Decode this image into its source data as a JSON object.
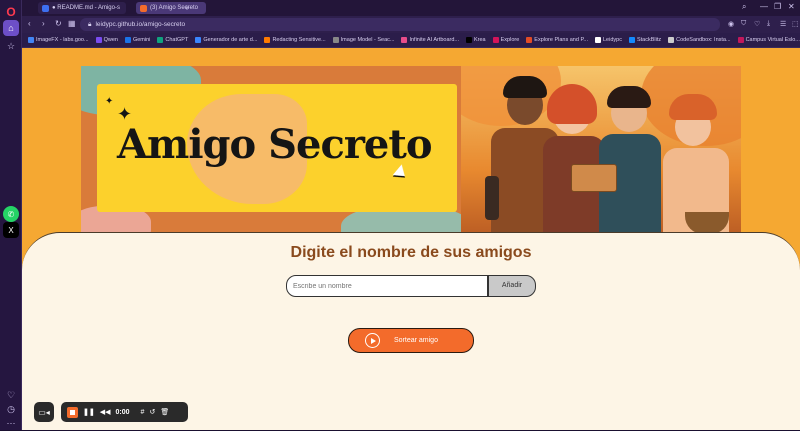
{
  "browser": {
    "tabs": [
      {
        "label": "● README.md - Amigo-s"
      },
      {
        "label": "(3) Amigo Secreto"
      }
    ],
    "new_tab_icon": "+",
    "url": "leidypc.github.io/amigo-secreto",
    "window_controls": {
      "search": "⌕",
      "minimize": "—",
      "restore": "❐",
      "close": "✕"
    }
  },
  "bookmarks": [
    {
      "label": "ImageFX - labs.goo...",
      "color": "#4285f4"
    },
    {
      "label": "Qwen",
      "color": "#7a4cf0"
    },
    {
      "label": "Gemini",
      "color": "#1a73e8"
    },
    {
      "label": "ChatGPT",
      "color": "#10a37f"
    },
    {
      "label": "Generador de arte d...",
      "color": "#3a86ff"
    },
    {
      "label": "Redacting Sensitive...",
      "color": "#ff7a00"
    },
    {
      "label": "Image Model - Seac...",
      "color": "#888888"
    },
    {
      "label": "Infinite AI Artboard...",
      "color": "#e84d8a"
    },
    {
      "label": "Krea",
      "color": "#000000"
    },
    {
      "label": "Explore",
      "color": "#d4145a"
    },
    {
      "label": "Explore Plans and P...",
      "color": "#e34c26"
    },
    {
      "label": "Leidypc",
      "color": "#ffffff"
    },
    {
      "label": "StackBlitz",
      "color": "#1389fd"
    },
    {
      "label": "CodeSandbox: Insta...",
      "color": "#cccccc"
    },
    {
      "label": "Campus Virtual Eslo...",
      "color": "#c2185b"
    }
  ],
  "banner": {
    "title": "Amigo Secreto"
  },
  "form": {
    "heading": "Digite el nombre de sus amigos",
    "input_placeholder": "Escribe un nombre",
    "add_label": "Añadir",
    "draw_label": "Sortear amigo"
  },
  "recorder": {
    "time": "0:00"
  }
}
